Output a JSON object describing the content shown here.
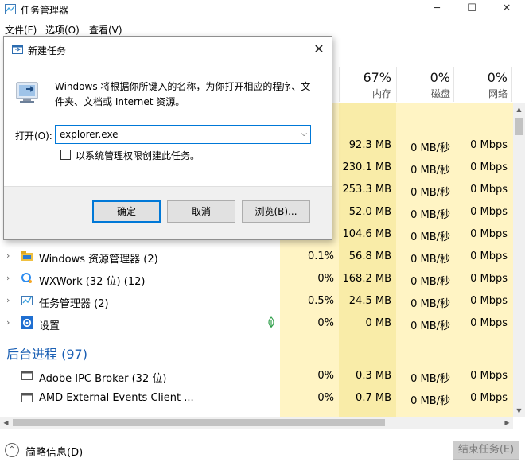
{
  "window": {
    "title": "任务管理器",
    "controls": {
      "minimize": "─",
      "maximize": "☐",
      "close": "✕"
    }
  },
  "menu": [
    "文件(F)",
    "选项(O)",
    "查看(V)"
  ],
  "columns": {
    "memory": {
      "percent": "67%",
      "label": "内存"
    },
    "disk": {
      "percent": "0%",
      "label": "磁盘"
    },
    "network": {
      "percent": "0%",
      "label": "网络"
    }
  },
  "processes": [
    {
      "name": "",
      "cpu": "",
      "memory": "92.3 MB",
      "disk": "0 MB/秒",
      "network": "0 Mbps",
      "icon": "hidden"
    },
    {
      "name": "",
      "cpu": "",
      "memory": "230.1 MB",
      "disk": "0 MB/秒",
      "network": "0 Mbps",
      "icon": "hidden"
    },
    {
      "name": "",
      "cpu": "",
      "memory": "253.3 MB",
      "disk": "0 MB/秒",
      "network": "0 Mbps",
      "icon": "hidden"
    },
    {
      "name": "",
      "cpu": "",
      "memory": "52.0 MB",
      "disk": "0 MB/秒",
      "network": "0 Mbps",
      "icon": "hidden"
    },
    {
      "name": "",
      "cpu": "",
      "memory": "104.6 MB",
      "disk": "0 MB/秒",
      "network": "0 Mbps",
      "icon": "hidden"
    },
    {
      "name": "Windows 资源管理器 (2)",
      "cpu": "0.1%",
      "memory": "56.8 MB",
      "disk": "0 MB/秒",
      "network": "0 Mbps",
      "icon": "folder-icon"
    },
    {
      "name": "WXWork (32 位) (12)",
      "cpu": "0%",
      "memory": "168.2 MB",
      "disk": "0 MB/秒",
      "network": "0 Mbps",
      "icon": "wxwork-icon"
    },
    {
      "name": "任务管理器 (2)",
      "cpu": "0.5%",
      "memory": "24.5 MB",
      "disk": "0 MB/秒",
      "network": "0 Mbps",
      "icon": "task-manager-icon"
    },
    {
      "name": "设置",
      "cpu": "0%",
      "memory": "0 MB",
      "disk": "0 MB/秒",
      "network": "0 Mbps",
      "icon": "gear-icon"
    }
  ],
  "background_group": "后台进程 (97)",
  "background_processes": [
    {
      "name": "Adobe IPC Broker (32 位)",
      "cpu": "0%",
      "memory": "0.3 MB",
      "disk": "0 MB/秒",
      "network": "0 Mbps"
    },
    {
      "name": "AMD External Events Client ...",
      "cpu": "0%",
      "memory": "0.7 MB",
      "disk": "0 MB/秒",
      "network": "0 Mbps"
    }
  ],
  "footer": {
    "brief": "简略信息(D)",
    "end_task": "结束任务(E)"
  },
  "dialog": {
    "title": "新建任务",
    "description": "Windows 将根据你所键入的名称，为你打开相应的程序、文件夹、文档或 Internet 资源。",
    "open_label": "打开(O):",
    "open_value": "explorer.exe",
    "admin_label": "以系统管理权限创建此任务。",
    "ok": "确定",
    "cancel": "取消",
    "browse": "浏览(B)..."
  },
  "colors": {
    "heat_light": "#fff4c4",
    "heat_medium": "#f9eca8",
    "accent": "#0078d7",
    "group_text": "#1a5fb4"
  }
}
